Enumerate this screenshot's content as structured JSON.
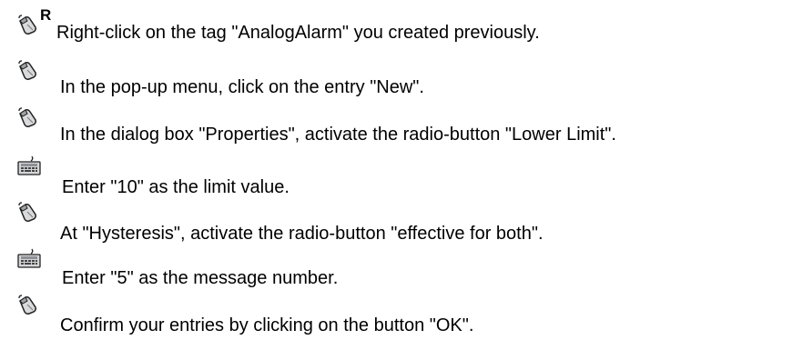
{
  "steps": [
    {
      "icon": "mouse-right-click-icon",
      "text": "Right-click on the tag \"AnalogAlarm\" you created previously."
    },
    {
      "icon": "mouse-click-icon",
      "text": "In the pop-up menu, click on the entry \"New\"."
    },
    {
      "icon": "mouse-click-icon",
      "text": "In the dialog box \"Properties\", activate the radio-button \"Lower Limit\"."
    },
    {
      "icon": "keyboard-icon",
      "text": "Enter \"10\" as the limit value."
    },
    {
      "icon": "mouse-click-icon",
      "text": "At \"Hysteresis\", activate the radio-button \"effective for both\"."
    },
    {
      "icon": "keyboard-icon",
      "text": "Enter \"5\" as the message number."
    },
    {
      "icon": "mouse-click-icon",
      "text": "Confirm your entries by clicking on the button \"OK\"."
    }
  ],
  "right_click_marker": "R"
}
